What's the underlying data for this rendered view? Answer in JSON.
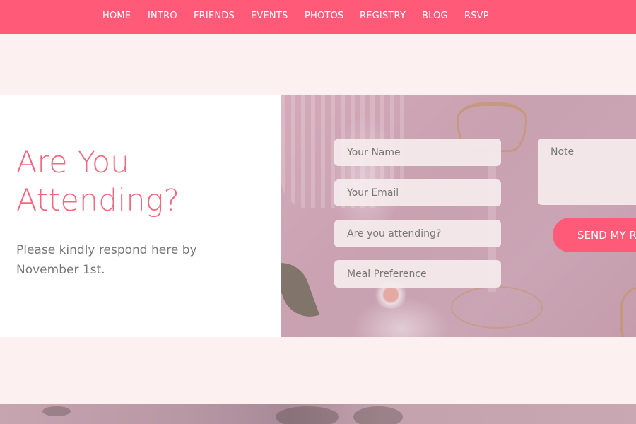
{
  "nav": {
    "items": [
      "HOME",
      "INTRO",
      "FRIENDS",
      "EVENTS",
      "PHOTOS",
      "REGISTRY",
      "BLOG",
      "RSVP"
    ]
  },
  "rsvp": {
    "heading": "Are You Attending?",
    "subtext": "Please kindly respond here by November 1st.",
    "form": {
      "name_placeholder": "Your Name",
      "email_placeholder": "Your Email",
      "attending_placeholder": "Are you attending?",
      "meal_placeholder": "Meal Preference",
      "note_placeholder": "Note",
      "send_label": "SEND MY RSVP"
    }
  },
  "colors": {
    "accent": "#ff5b78",
    "heading": "#f4687f",
    "background": "#fcf1f0"
  }
}
